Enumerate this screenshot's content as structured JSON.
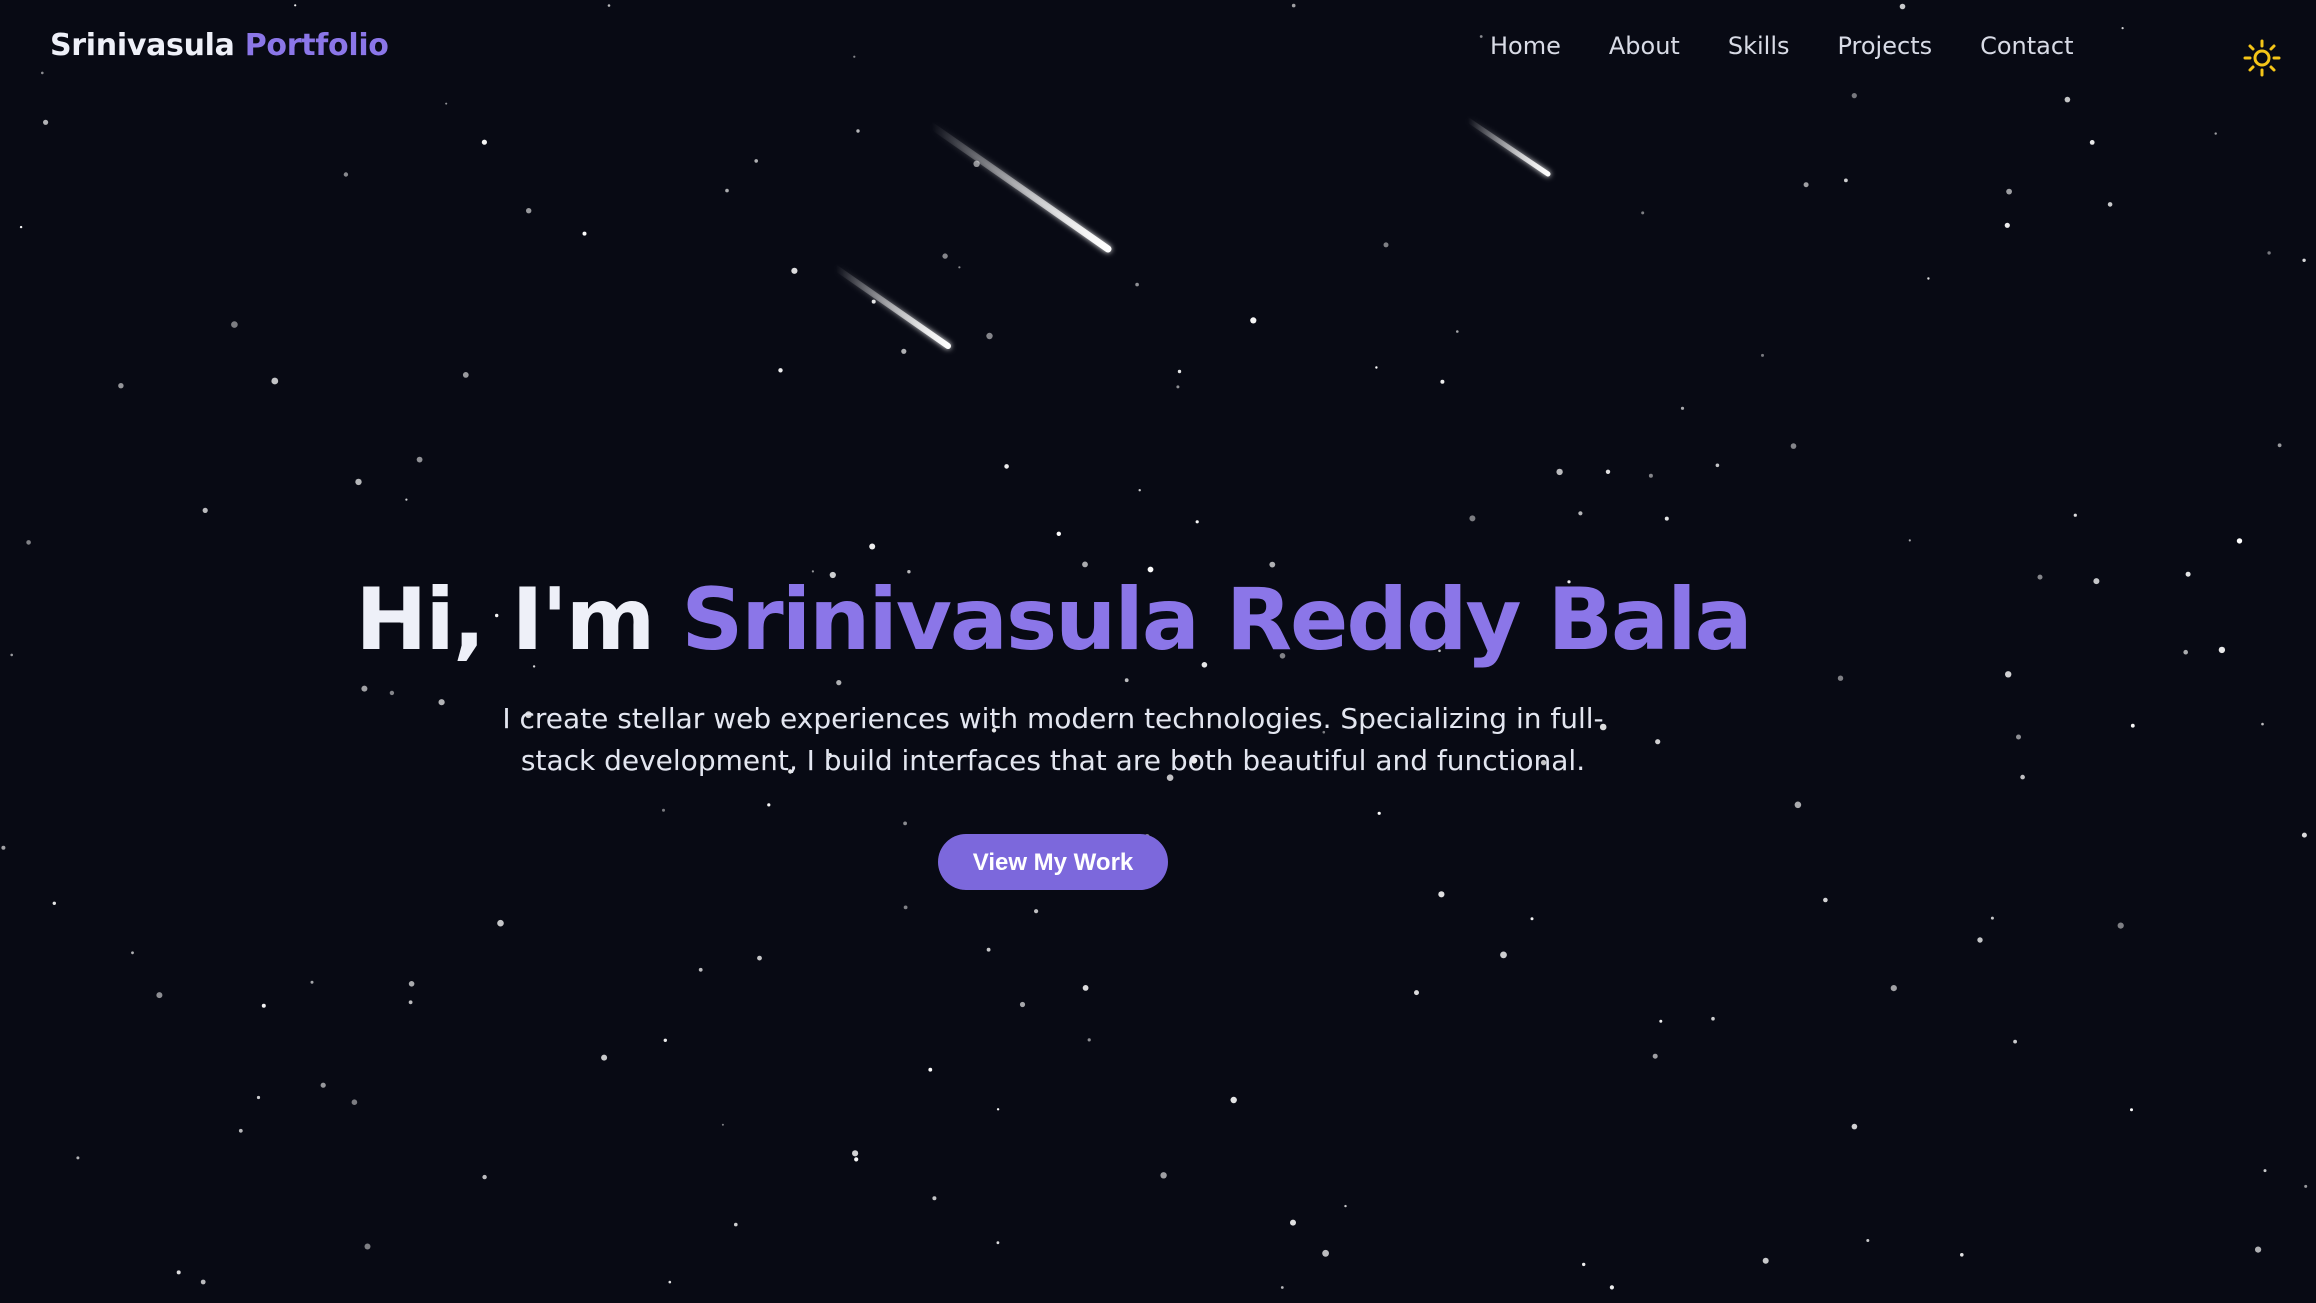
{
  "header": {
    "logo_primary": "Srinivasula",
    "logo_accent": "Portfolio",
    "nav": [
      "Home",
      "About",
      "Skills",
      "Projects",
      "Contact"
    ],
    "theme_icon": "sun-icon"
  },
  "hero": {
    "greeting": "Hi, I'm ",
    "name": "Srinivasula Reddy Bala",
    "subtitle": "I create stellar web experiences with modern technologies. Specializing in full-stack development, I build interfaces that are both beautiful and functional.",
    "cta_label": "View My Work"
  },
  "colors": {
    "background": "#080a14",
    "accent": "#8b76e8",
    "button": "#7c68dc",
    "sun": "#f5c518"
  }
}
